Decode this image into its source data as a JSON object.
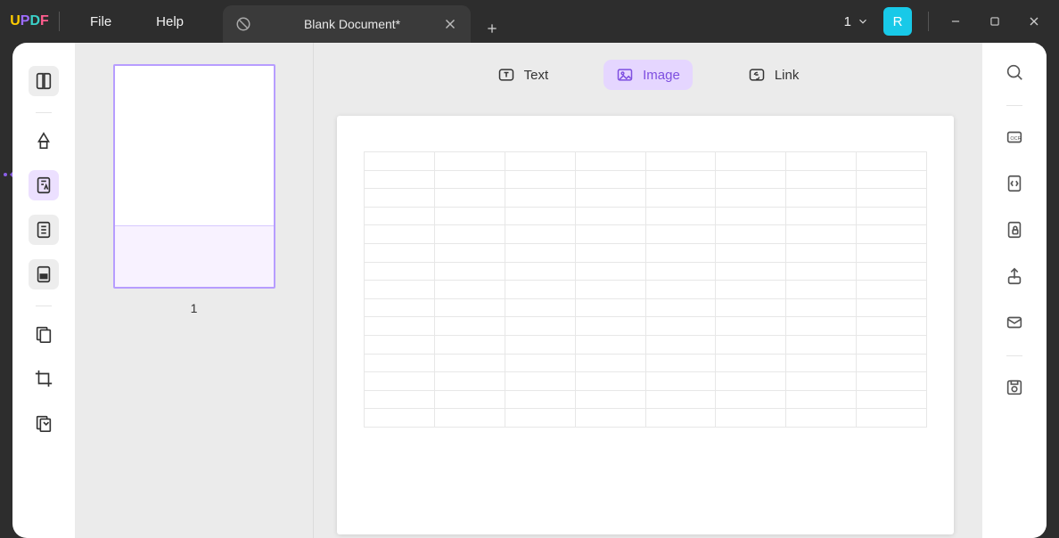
{
  "title_bar": {
    "logo": {
      "u": "U",
      "p": "P",
      "d": "D",
      "f": "F"
    },
    "menus": {
      "file": "File",
      "help": "Help"
    },
    "tab": {
      "title": "Blank Document*"
    },
    "page_indicator": "1",
    "avatar_initial": "R"
  },
  "thumbnail": {
    "page_number": "1"
  },
  "edit_toolbar": {
    "text": "Text",
    "image": "Image",
    "link": "Link",
    "active": "image"
  },
  "table": {
    "rows": 15,
    "cols": 8
  }
}
